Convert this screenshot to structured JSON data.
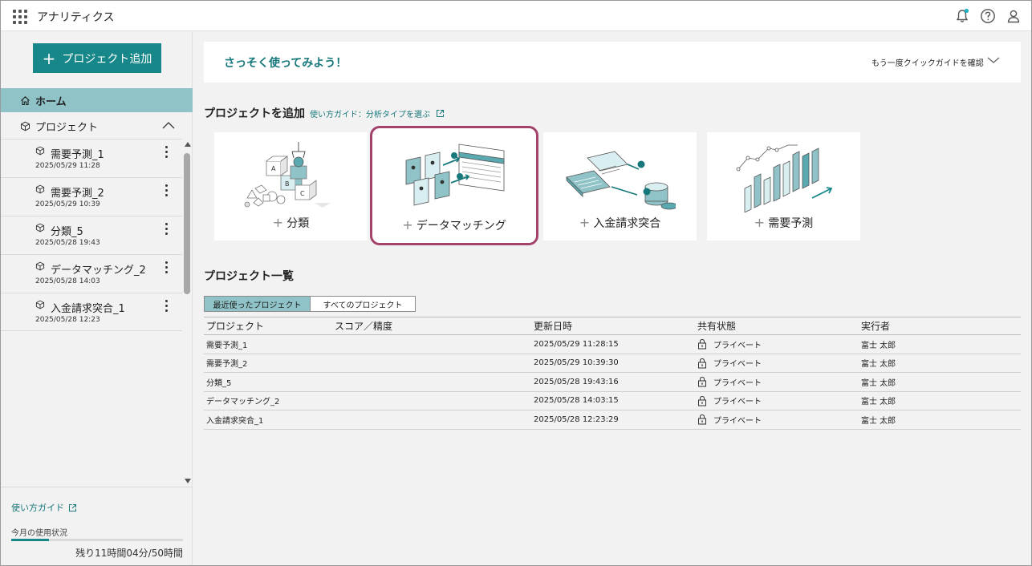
{
  "app": {
    "title": "アナリティクス"
  },
  "sidebar": {
    "add_button": "プロジェクト追加",
    "home": "ホーム",
    "projects_label": "プロジェクト",
    "items": [
      {
        "name": "需要予測_1",
        "date": "2025/05/29 11:28"
      },
      {
        "name": "需要予測_2",
        "date": "2025/05/29 10:39"
      },
      {
        "name": "分類_5",
        "date": "2025/05/28 19:43"
      },
      {
        "name": "データマッチング_2",
        "date": "2025/05/28 14:03"
      },
      {
        "name": "入金請求突合_1",
        "date": "2025/05/28 12:23"
      }
    ],
    "guide_link": "使い方ガイド",
    "usage_label": "今月の使用状況",
    "usage_fraction": 0.22,
    "usage_remaining": "残り11時間04分/50時間"
  },
  "banner": {
    "title": "さっそく使ってみよう！",
    "link": "もう一度クイックガイドを確認"
  },
  "add_section": {
    "title": "プロジェクトを追加",
    "guide": "使い方ガイド：分析タイプを選ぶ",
    "cards": [
      "分類",
      "データマッチング",
      "入金請求突合",
      "需要予測"
    ]
  },
  "list_section": {
    "title": "プロジェクト一覧",
    "tabs": [
      "最近使ったプロジェクト",
      "すべてのプロジェクト"
    ],
    "columns": [
      "プロジェクト",
      "スコア／精度",
      "更新日時",
      "共有状態",
      "実行者"
    ],
    "rows": [
      {
        "project": "需要予測_1",
        "score": "",
        "updated": "2025/05/29 11:28:15",
        "share": "プライベート",
        "owner": "富士 太郎"
      },
      {
        "project": "需要予測_2",
        "score": "",
        "updated": "2025/05/29 10:39:30",
        "share": "プライベート",
        "owner": "富士 太郎"
      },
      {
        "project": "分類_5",
        "score": "",
        "updated": "2025/05/28 19:43:16",
        "share": "プライベート",
        "owner": "富士 太郎"
      },
      {
        "project": "データマッチング_2",
        "score": "",
        "updated": "2025/05/28 14:03:15",
        "share": "プライベート",
        "owner": "富士 太郎"
      },
      {
        "project": "入金請求突合_1",
        "score": "",
        "updated": "2025/05/28 12:23:29",
        "share": "プライベート",
        "owner": "富士 太郎"
      }
    ]
  },
  "colors": {
    "accent": "#17878a",
    "selected_nav": "#8fc3c7",
    "highlight_border": "#a3426a"
  }
}
